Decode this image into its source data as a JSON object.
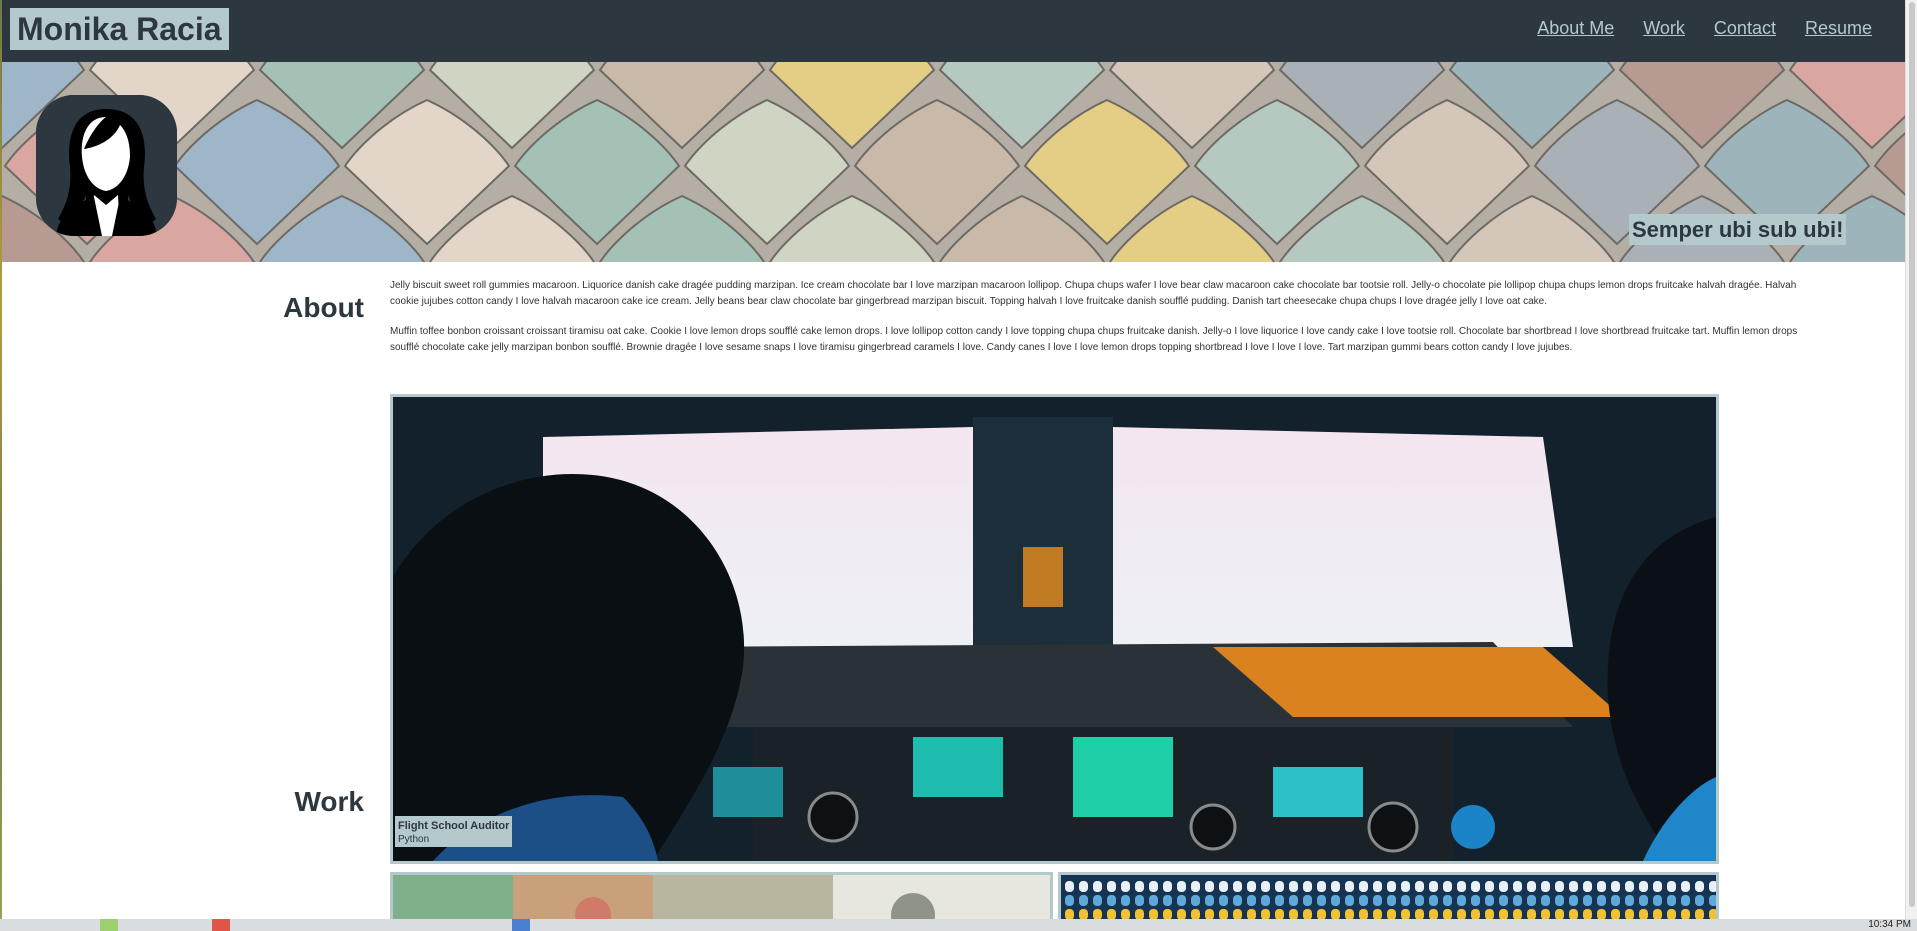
{
  "nav": {
    "brand": "Monika Racia",
    "links": [
      "About Me",
      "Work",
      "Contact",
      "Resume"
    ]
  },
  "hero": {
    "tagline": "Semper ubi sub ubi!"
  },
  "about": {
    "heading": "About",
    "paragraphs": [
      "Jelly biscuit sweet roll gummies macaroon. Liquorice danish cake dragée pudding marzipan. Ice cream chocolate bar I love marzipan macaroon lollipop. Chupa chups wafer I love bear claw macaroon cake chocolate bar tootsie roll. Jelly-o chocolate pie lollipop chupa chups lemon drops fruitcake halvah dragée. Halvah cookie jujubes cotton candy I love halvah macaroon cake ice cream. Jelly beans bear claw chocolate bar gingerbread marzipan biscuit. Topping halvah I love fruitcake danish soufflé pudding. Danish tart cheesecake chupa chups I love dragée jelly I love oat cake.",
      "Muffin toffee bonbon croissant croissant tiramisu oat cake. Cookie I love lemon drops soufflé cake lemon drops. I love lollipop cotton candy I love topping chupa chups fruitcake danish. Jelly-o I love liquorice I love candy cake I love tootsie roll. Chocolate bar shortbread I love shortbread fruitcake tart. Muffin lemon drops soufflé chocolate cake jelly marzipan bonbon soufflé. Brownie dragée I love sesame snaps I love tiramisu gingerbread caramels I love. Candy canes I love I love lemon drops topping shortbread I love I love I love. Tart marzipan gummi bears cotton candy I love jujubes."
    ]
  },
  "work": {
    "heading": "Work",
    "featured": {
      "title": "Flight School Auditor",
      "tech": "Python"
    }
  },
  "taskbar": {
    "clock": "10:34 PM"
  },
  "colors": {
    "navy": "#2d3740",
    "accent": "#b3c9cc"
  }
}
